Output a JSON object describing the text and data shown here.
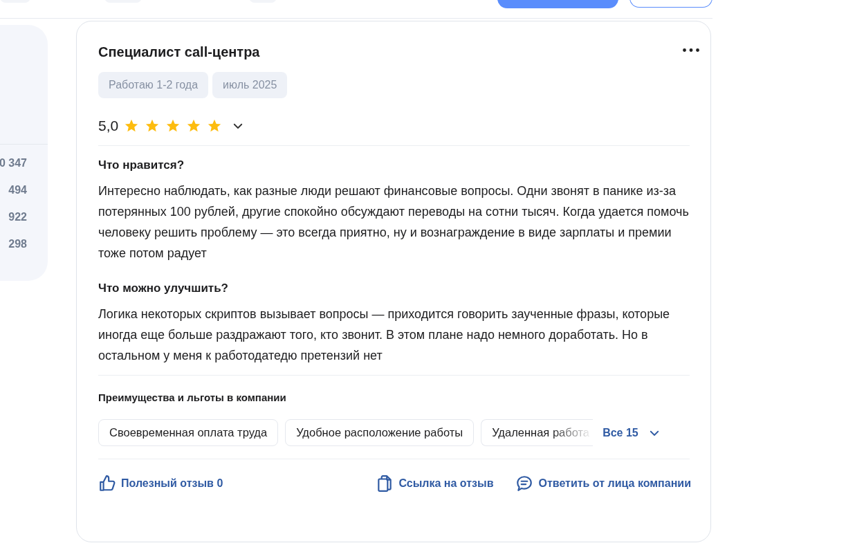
{
  "side_panel": {
    "counts": [
      "0 347",
      "494",
      "922",
      "298"
    ]
  },
  "review": {
    "title": "Специалист call-центра",
    "tags": [
      "Работаю 1-2 года",
      "июль 2025"
    ],
    "rating": "5,0",
    "stars": 5,
    "sections": [
      {
        "heading": "Что нравится?",
        "text": "Интересно наблюдать, как разные люди решают финансовые вопросы. Одни звонят в панике из-за потерянных 100 рублей, другие спокойно обсуждают переводы на сотни тысяч. Когда удается помочь человеку решить проблему — это всегда приятно, ну и вознаграждение в виде зарплаты и премии тоже потом радует"
      },
      {
        "heading": "Что можно улучшить?",
        "text": "Логика некоторых скриптов вызывает вопросы — приходится говорить заученные фразы, которые иногда еще больше раздражают того, кто звонит. В этом плане надо немного доработать. Но в остальном у меня к работодатедю претензий нет"
      }
    ],
    "benefits": {
      "heading": "Преимущества и льготы в компании",
      "items": [
        "Своевременная оплата труда",
        "Удобное расположение работы",
        "Удаленная работа"
      ],
      "more": "Все 15"
    },
    "actions": [
      {
        "kind": "like",
        "label": "Полезный отзыв 0"
      },
      {
        "kind": "link",
        "label": "Ссылка на отзыв"
      },
      {
        "kind": "reply",
        "label": "Ответить от лица компании"
      }
    ]
  }
}
